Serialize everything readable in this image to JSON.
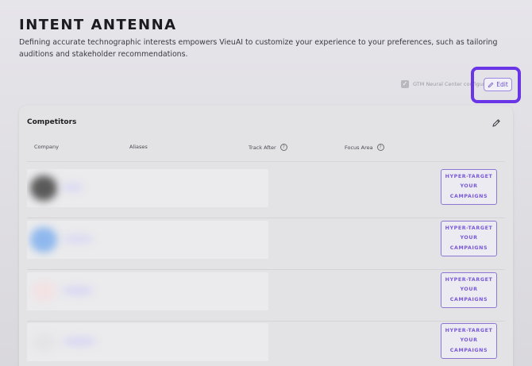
{
  "page": {
    "title": "INTENT ANTENNA",
    "description": "Defining accurate technographic interests empowers VieuAI to customize your experience to your preferences, such as tailoring auditions and stakeholder recommendations."
  },
  "toolbar": {
    "gtm_label": "GTM Neural Center configured",
    "gtm_checked": true,
    "edit_label": "Edit"
  },
  "competitors": {
    "title": "Competitors",
    "columns": {
      "company": "Company",
      "aliases": "Aliases",
      "track_after": "Track After",
      "focus_area": "Focus Area"
    },
    "rows": [
      {
        "cta_line1": "HYPER-TARGET",
        "cta_line2": "YOUR",
        "cta_line3": "CAMPAIGNS"
      },
      {
        "cta_line1": "HYPER-TARGET",
        "cta_line2": "YOUR",
        "cta_line3": "CAMPAIGNS"
      },
      {
        "cta_line1": "HYPER-TARGET",
        "cta_line2": "YOUR",
        "cta_line3": "CAMPAIGNS"
      },
      {
        "cta_line1": "HYPER-TARGET",
        "cta_line2": "YOUR",
        "cta_line3": "CAMPAIGNS"
      }
    ]
  },
  "colors": {
    "accent": "#6a35e6",
    "cta_text": "#7858d8"
  },
  "icons": {
    "edit": "pencil-icon",
    "help": "question-circle-icon",
    "check": "check-icon"
  }
}
